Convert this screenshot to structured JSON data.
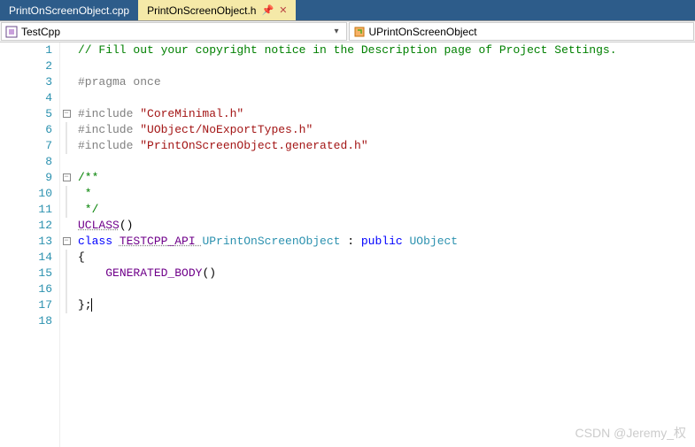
{
  "tabs": {
    "inactive": "PrintOnScreenObject.cpp",
    "active": "PrintOnScreenObject.h"
  },
  "nav": {
    "module": "TestCpp",
    "class": "UPrintOnScreenObject"
  },
  "lines": {
    "l1_comment": "// Fill out your copyright notice in the Description page of Project Settings.",
    "l3_pragma": "#pragma once",
    "l5_inc_kw": "#include ",
    "l5_inc_str": "\"CoreMinimal.h\"",
    "l6_inc_kw": "#include ",
    "l6_inc_str": "\"UObject/NoExportTypes.h\"",
    "l7_inc_kw": "#include ",
    "l7_inc_str": "\"PrintOnScreenObject.generated.h\"",
    "l9_c": "/**",
    "l10_c": " * ",
    "l11_c": " */",
    "l12_uclass": "UCLASS",
    "l12_paren": "()",
    "l13_kw_class": "class ",
    "l13_macro": "TESTCPP_API ",
    "l13_type": "UPrintOnScreenObject",
    "l13_mid": " : ",
    "l13_kw_pub": "public ",
    "l13_base": "UObject",
    "l14_brace": "{",
    "l15_indent": "    ",
    "l15_gen": "GENERATED_BODY",
    "l15_paren": "()",
    "l17_brace": "};"
  },
  "watermark": "CSDN @Jeremy_权"
}
